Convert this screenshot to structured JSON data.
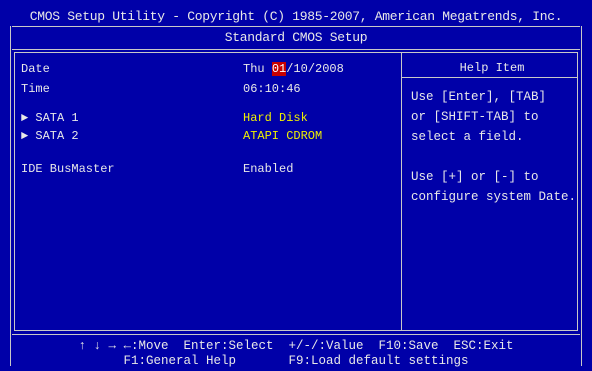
{
  "header": {
    "title": "CMOS Setup Utility - Copyright (C) 1985-2007, American Megatrends, Inc.",
    "subtitle": "Standard CMOS Setup"
  },
  "fields": {
    "date": {
      "label": "Date",
      "day": "Thu",
      "month": "01",
      "rest": "/10/2008"
    },
    "time": {
      "label": "Time",
      "value": "06:10:46"
    },
    "sata1": {
      "label": "SATA 1",
      "value": "Hard Disk"
    },
    "sata2": {
      "label": "SATA 2",
      "value": "ATAPI CDROM"
    },
    "ide": {
      "label": "IDE BusMaster",
      "value": "Enabled"
    }
  },
  "help": {
    "title": "Help Item",
    "text": "Use [Enter], [TAB]\nor [SHIFT-TAB] to\nselect a field.\n\nUse [+] or [-] to\nconfigure system Date."
  },
  "footer": {
    "line1": "↑ ↓ → ←:Move  Enter:Select  +/-/:Value  F10:Save  ESC:Exit",
    "line2": "F1:General Help       F9:Load default settings"
  },
  "colors": {
    "background": "#0000a8",
    "text": "#e8e8e8",
    "highlight": "#c80000",
    "submenu_value": "#f0f000"
  }
}
